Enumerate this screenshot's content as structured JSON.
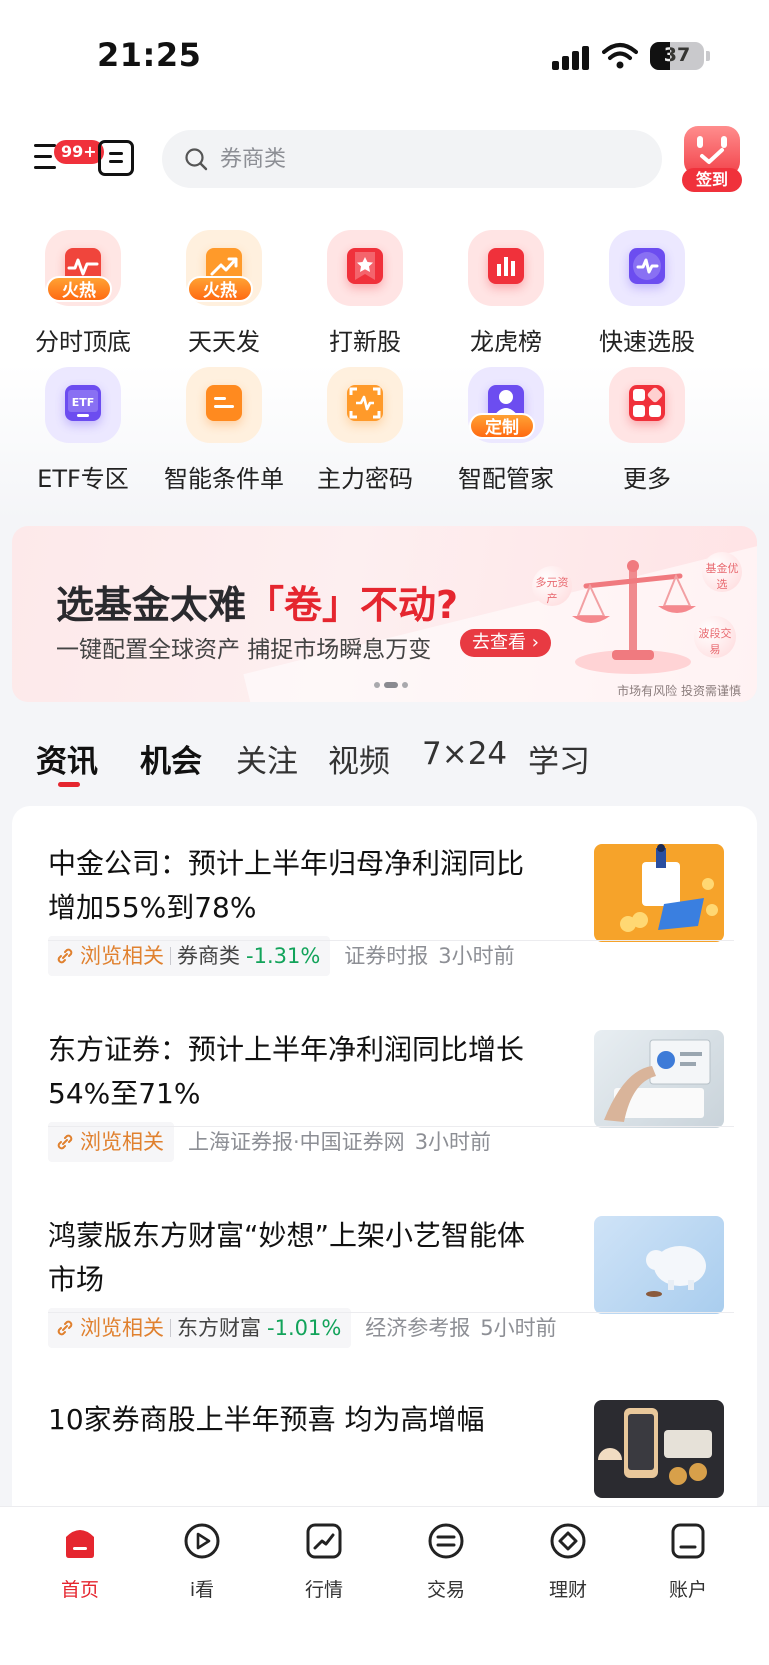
{
  "status_bar": {
    "time": "21:25",
    "battery": "37",
    "battery_level": 0.37
  },
  "header": {
    "menu_badge": "99+",
    "search_placeholder": "券商类",
    "checkin_label": "签到"
  },
  "quick_grid": [
    {
      "label": "分时顶底",
      "icon": "intraday-chart-icon",
      "badge": "火热",
      "color": "#f0453c",
      "bg": "#ffe6e4"
    },
    {
      "label": "天天发",
      "icon": "trend-up-icon",
      "badge": "火热",
      "color": "#ff9a2a",
      "bg": "#fff0de"
    },
    {
      "label": "打新股",
      "icon": "star-bookmark-icon",
      "badge": "",
      "color": "#f0313b",
      "bg": "#ffe4e4"
    },
    {
      "label": "龙虎榜",
      "icon": "ranking-bars-icon",
      "badge": "",
      "color": "#f0313b",
      "bg": "#ffe4e4"
    },
    {
      "label": "快速选股",
      "icon": "quick-pick-icon",
      "badge": "",
      "color": "#6c4df0",
      "bg": "#ece8ff"
    },
    {
      "label": "ETF专区",
      "icon": "etf-monitor-icon",
      "badge": "",
      "color": "#6c4df0",
      "bg": "#ece8ff"
    },
    {
      "label": "智能条件单",
      "icon": "smart-order-icon",
      "badge": "",
      "color": "#ff8a1f",
      "bg": "#fff0de"
    },
    {
      "label": "主力密码",
      "icon": "scan-pulse-icon",
      "badge": "",
      "color": "#ff9a2a",
      "bg": "#fff0de"
    },
    {
      "label": "智配管家",
      "icon": "advisor-person-icon",
      "badge": "定制",
      "color": "#6c4df0",
      "bg": "#ece8ff"
    },
    {
      "label": "更多",
      "icon": "more-apps-icon",
      "badge": "",
      "color": "#f0313b",
      "bg": "#ffe4e4"
    }
  ],
  "banner": {
    "headline_pre": "选基金太难",
    "headline_em": "「卷」不动?",
    "subtitle": "一键配置全球资产 捕捉市场瞬息万变",
    "cta": "去查看 ›",
    "risk_note": "市场有风险 投资需谨慎",
    "bubbles": [
      "多元资产",
      "基金优选",
      "波段交易"
    ]
  },
  "tabs": [
    "资讯",
    "机会",
    "关注",
    "视频",
    "7×24",
    "学习"
  ],
  "news": [
    {
      "title": "中金公司：预计上半年归母净利润同比增加55%到78%",
      "related": "浏览相关",
      "stock": "券商类",
      "change": "-1.31%",
      "source": "证券时报",
      "ago": "3小时前",
      "thumb": "illustration-orange"
    },
    {
      "title": "东方证券：预计上半年净利润同比增长54%至71%",
      "related": "浏览相关",
      "stock": "",
      "change": "",
      "source": "上海证券报·中国证券网",
      "ago": "3小时前",
      "thumb": "photo-charts-desk"
    },
    {
      "title": "鸿蒙版东方财富“妙想”上架小艺智能体市场",
      "related": "浏览相关",
      "stock": "东方财富",
      "change": "-1.01%",
      "source": "经济参考报",
      "ago": "5小时前",
      "thumb": "photo-piggy-bank"
    },
    {
      "title": "10家券商股上半年预喜 均为高增幅",
      "thumb": "photo-phone-coins"
    }
  ],
  "bottom_nav": [
    {
      "label": "首页",
      "icon": "home-icon",
      "active": true
    },
    {
      "label": "i看",
      "icon": "play-circle-icon",
      "active": false
    },
    {
      "label": "行情",
      "icon": "market-chart-icon",
      "active": false
    },
    {
      "label": "交易",
      "icon": "trade-icon",
      "active": false
    },
    {
      "label": "理财",
      "icon": "wealth-icon",
      "active": false
    },
    {
      "label": "账户",
      "icon": "account-icon",
      "active": false
    }
  ],
  "colors": {
    "accent": "#e5262f",
    "down_green": "#12a35a",
    "related_orange": "#e0812f"
  }
}
